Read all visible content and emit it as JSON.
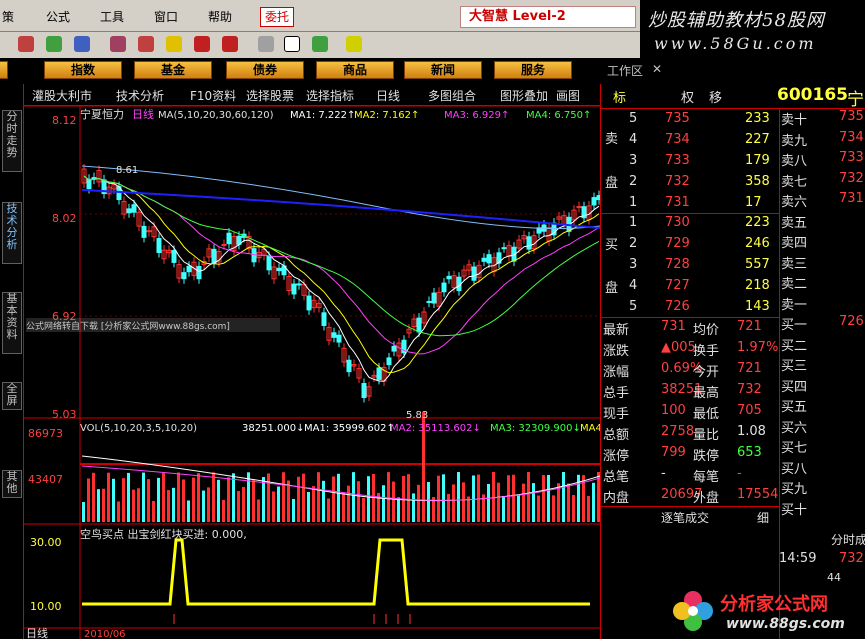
{
  "menubar": {
    "items": [
      "策",
      "公式",
      "工具",
      "窗口",
      "帮助"
    ],
    "trust": "委托",
    "brand": "大智慧 Level-2"
  },
  "logo": {
    "line1": "炒股辅助教材58股网",
    "line2": "www.58Gu.com"
  },
  "categories": [
    "指数",
    "基金",
    "债券",
    "商品",
    "新闻",
    "服务"
  ],
  "workarea": "工作区",
  "sidebar": [
    "分时走势",
    "技术分析",
    "基本资料",
    "全屏",
    "其他"
  ],
  "subtabs": [
    "灌股大利市",
    "技术分析",
    "F10资料",
    "选择股票",
    "选择指标",
    "日线",
    "多图组合",
    "图形叠加",
    "画图"
  ],
  "chart": {
    "stock": "宁夏恒力",
    "period": "日线",
    "ma_header": "MA(5,10,20,30,60,120)",
    "ma_values": [
      "MA1: 7.222↑",
      "MA2: 7.162↑",
      "MA3: 6.929↑",
      "MA4: 6.750↑"
    ],
    "price_ticks": [
      "8.12",
      "8.02",
      "6.92",
      "5.03"
    ],
    "high_label": "8.61",
    "low_label": "5.83",
    "watermark": "公式网络转自下载 [分析家公式网www.88gs.com]",
    "vol_header": "VOL(5,10,20,3,5,10,20)",
    "vol_values": [
      "38251.000↓",
      "MA1: 35999.602↑",
      "MA2: 35113.602↓",
      "MA3: 32309.900↓",
      "MA4:"
    ],
    "vol_ticks": [
      "86973",
      "43407"
    ],
    "ind_header": "空鸟买点  出宝剑红块买进: 0.000,",
    "ind_ticks": [
      "30.00",
      "10.00"
    ],
    "bottom_label": "日线",
    "date_label": "2010/06"
  },
  "colors": {
    "up": "#ff3030",
    "down": "#40ffff",
    "ma1": "#ffffff",
    "ma2": "#ffff00",
    "ma3": "#ff40ff",
    "ma4": "#40ff40",
    "ma5": "#80c0ff",
    "ma6": "#2020ff",
    "signal": "#ffff00"
  },
  "right": {
    "tabs": [
      "标",
      "权",
      "移"
    ],
    "code": "600165",
    "name": "宁",
    "sell_label": "卖盘",
    "buy_label": "买盘",
    "sells": [
      {
        "lv": "5",
        "p": "735",
        "v": "233"
      },
      {
        "lv": "4",
        "p": "734",
        "v": "227"
      },
      {
        "lv": "3",
        "p": "733",
        "v": "179"
      },
      {
        "lv": "2",
        "p": "732",
        "v": "358"
      },
      {
        "lv": "1",
        "p": "731",
        "v": "17"
      }
    ],
    "buys": [
      {
        "lv": "1",
        "p": "730",
        "v": "223"
      },
      {
        "lv": "2",
        "p": "729",
        "v": "246"
      },
      {
        "lv": "3",
        "p": "728",
        "v": "557"
      },
      {
        "lv": "4",
        "p": "727",
        "v": "218"
      },
      {
        "lv": "5",
        "p": "726",
        "v": "143"
      }
    ],
    "level2": [
      "卖十",
      "卖九",
      "卖八",
      "卖七",
      "卖六",
      "卖五",
      "卖四",
      "卖三",
      "卖二",
      "卖一",
      "买一",
      "买二",
      "买三",
      "买四",
      "买五",
      "买六",
      "买七",
      "买八",
      "买九",
      "买十"
    ],
    "level2_prices": [
      "735",
      "734",
      "733",
      "732",
      "731",
      "",
      "",
      "",
      "",
      "",
      "726"
    ],
    "stats": [
      {
        "k1": "最新",
        "v1": "731",
        "k2": "均价",
        "v2": "721"
      },
      {
        "k1": "涨跌",
        "v1": "▲005",
        "k2": "换手",
        "v2": "1.97%"
      },
      {
        "k1": "涨幅",
        "v1": "0.69%",
        "k2": "今开",
        "v2": "721"
      },
      {
        "k1": "总手",
        "v1": "38251",
        "k2": "最高",
        "v2": "732"
      },
      {
        "k1": "现手",
        "v1": "100",
        "k2": "最低",
        "v2": "705"
      },
      {
        "k1": "总额",
        "v1": "2758",
        "k2": "量比",
        "v2": "1.08"
      },
      {
        "k1": "涨停",
        "v1": "799",
        "k2": "跌停",
        "v2": "653"
      },
      {
        "k1": "总笔",
        "v1": "-",
        "k2": "每笔",
        "v2": "-"
      },
      {
        "k1": "内盘",
        "v1": "20697",
        "k2": "外盘",
        "v2": "17554"
      }
    ],
    "tick_title": "逐笔成交",
    "tick_btn": "细",
    "ts_title": "分时成交",
    "ts_rows": [
      {
        "t": "14:59",
        "p": "732"
      },
      {
        "t": "",
        "p": "44"
      }
    ]
  },
  "fenxi": {
    "name": "分析家公式网",
    "url": "www.88gs.com"
  }
}
